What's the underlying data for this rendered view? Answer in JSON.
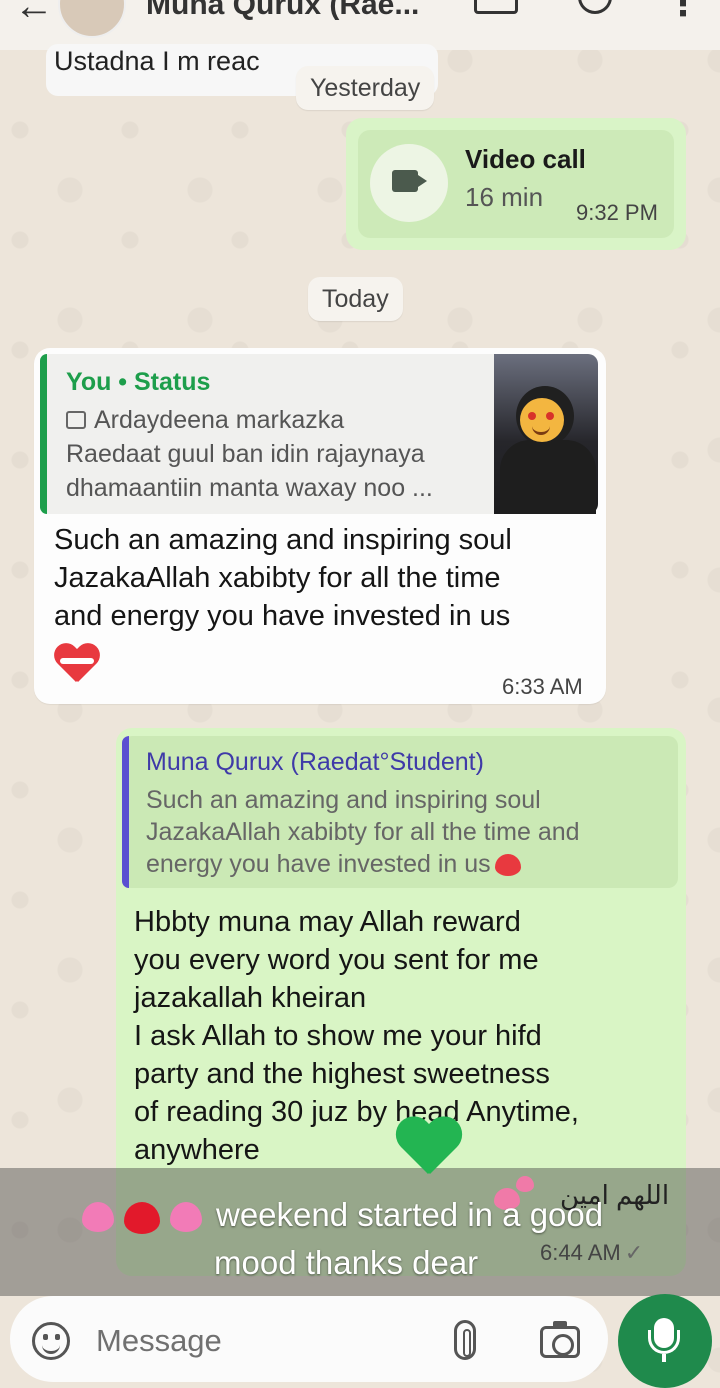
{
  "header": {
    "contact_name": "Muna Qurux (Rae...",
    "back_icon": "back-arrow-icon",
    "video_icon": "video-call-icon",
    "call_icon": "phone-icon",
    "menu_icon": "more-vert-icon"
  },
  "chat": {
    "partial_message": "Ustadna I m reac",
    "date_chips": {
      "yesterday": "Yesterday",
      "today": "Today"
    },
    "video_call": {
      "title": "Video call",
      "duration": "16 min",
      "time": "9:32 PM"
    },
    "incoming": {
      "quote_title": "You • Status",
      "quote_lines": [
        "Ardaydeena markazka",
        "Raedaat guul ban idin rajaynaya",
        "dhamaantiin manta waxay noo ..."
      ],
      "message_lines": [
        "Such an amazing and inspiring soul",
        "JazakaAllah xabibty for all the time",
        "and energy you have invested in us"
      ],
      "time": "6:33 AM"
    },
    "outgoing": {
      "reply_name": "Muna Qurux (Raedat°Student)",
      "reply_lines": [
        "Such an amazing and inspiring soul",
        "JazakaAllah xabibty for all the time and",
        "energy you have invested in us"
      ],
      "message_lines": [
        "Hbbty muna may Allah reward",
        "you every word you sent for me",
        "jazakallah kheiran",
        "I ask Allah to show me your hifd",
        "party and the highest sweetness",
        "of reading 30 juz by head Anytime,",
        "anywhere"
      ],
      "arabic": "اللهم امين",
      "time": "6:44 AM",
      "tick": "✓"
    }
  },
  "caption": {
    "line1": "weekend started in a good",
    "line2": "mood thanks dear"
  },
  "input": {
    "placeholder": "Message",
    "emoji_icon": "emoji-icon",
    "attach_icon": "attach-icon",
    "camera_icon": "camera-icon",
    "mic_icon": "mic-icon"
  },
  "colors": {
    "outgoing_bubble": "#d9f5c5",
    "incoming_bubble": "#fdfdfd",
    "accent_green": "#1d9e4b",
    "mic_button": "#1f8a4c",
    "reply_bar": "#5a4fd1"
  }
}
